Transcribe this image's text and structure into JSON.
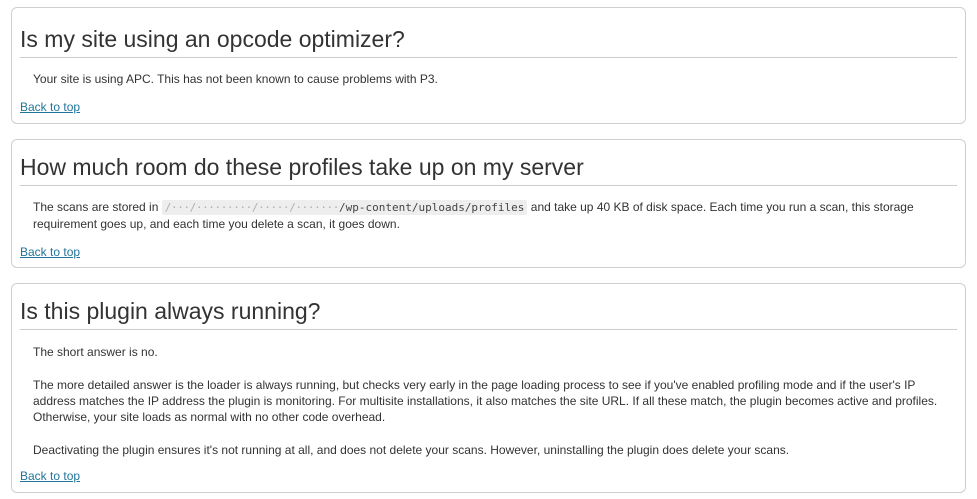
{
  "sections": [
    {
      "title": "Is my site using an opcode optimizer?",
      "answer": "Your site is using APC. This has not been known to cause problems with P3.",
      "back_link": "Back to top"
    },
    {
      "title": "How much room do these profiles take up on my server",
      "answer_before": "The scans are stored in",
      "path_redacted": "/···/·········/·····/·······",
      "path_visible": "/wp-content/uploads/profiles",
      "answer_after": "and take up 40 KB of disk space. Each time you run a scan, this storage requirement goes up, and each time you delete a scan, it goes down.",
      "back_link": "Back to top"
    },
    {
      "title": "Is this plugin always running?",
      "paragraphs": [
        "The short answer is no.",
        "The more detailed answer is the loader is always running, but checks very early in the page loading process to see if you've enabled profiling mode and if the user's IP address matches the IP address the plugin is monitoring. For multisite installations, it also matches the site URL. If all these match, the plugin becomes active and profiles. Otherwise, your site loads as normal with no other code overhead.",
        "Deactivating the plugin ensures it's not running at all, and does not delete your scans. However, uninstalling the plugin does delete your scans."
      ],
      "back_link": "Back to top"
    }
  ]
}
